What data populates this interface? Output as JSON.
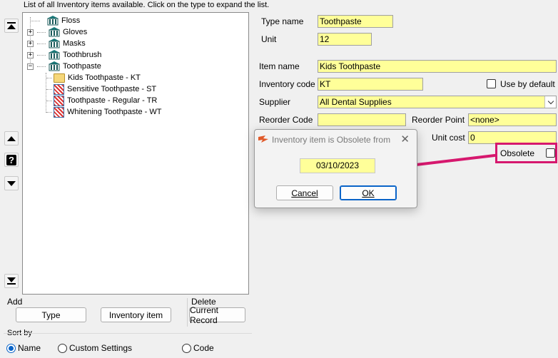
{
  "header": {
    "instruction": "List of all Inventory items available. Click on the type to expand the list."
  },
  "tree": {
    "categories": [
      {
        "label": "Floss",
        "expanded": false,
        "has_children": false
      },
      {
        "label": "Gloves",
        "expanded": false,
        "has_children": true
      },
      {
        "label": "Masks",
        "expanded": false,
        "has_children": true
      },
      {
        "label": "Toothbrush",
        "expanded": false,
        "has_children": true
      },
      {
        "label": "Toothpaste",
        "expanded": true,
        "has_children": true
      }
    ],
    "children": [
      {
        "label": "Kids Toothpaste - KT",
        "icon": "folder-open-icon"
      },
      {
        "label": "Sensitive Toothpaste - ST",
        "icon": "item-icon"
      },
      {
        "label": "Toothpaste - Regular - TR",
        "icon": "item-icon"
      },
      {
        "label": "Whitening Toothpaste - WT",
        "icon": "item-icon"
      }
    ]
  },
  "nav": {
    "top": "move-first-icon",
    "up": "move-up-icon",
    "help": "?",
    "down": "move-down-icon",
    "bottom": "move-last-icon"
  },
  "add": {
    "label": "Add",
    "type_button": "Type",
    "item_button": "Inventory item"
  },
  "delete": {
    "label": "Delete",
    "button": "Current Record"
  },
  "sort": {
    "label": "Sort by",
    "options": [
      "Name",
      "Custom Settings",
      "Code"
    ],
    "selected": "Name"
  },
  "form": {
    "type_name_label": "Type name",
    "type_name": "Toothpaste",
    "unit_label": "Unit",
    "unit": "12",
    "item_name_label": "Item name",
    "item_name": "Kids Toothpaste",
    "inventory_code_label": "Inventory code",
    "inventory_code": "KT",
    "use_by_default_label": "Use by default",
    "supplier_label": "Supplier",
    "supplier": "All Dental Supplies",
    "reorder_code_label": "Reorder Code",
    "reorder_code": "",
    "reorder_point_label": "Reorder Point",
    "reorder_point": "<none>",
    "unit_cost_label": "Unit cost",
    "unit_cost": "0",
    "obsolete_label": "Obsolete"
  },
  "dialog": {
    "title": "Inventory item is Obsolete from",
    "date": "03/10/2023",
    "cancel": "Cancel",
    "ok": "OK"
  },
  "colors": {
    "field_bg": "#ffff99",
    "highlight": "#d6186e",
    "accent": "#0a64c8"
  }
}
